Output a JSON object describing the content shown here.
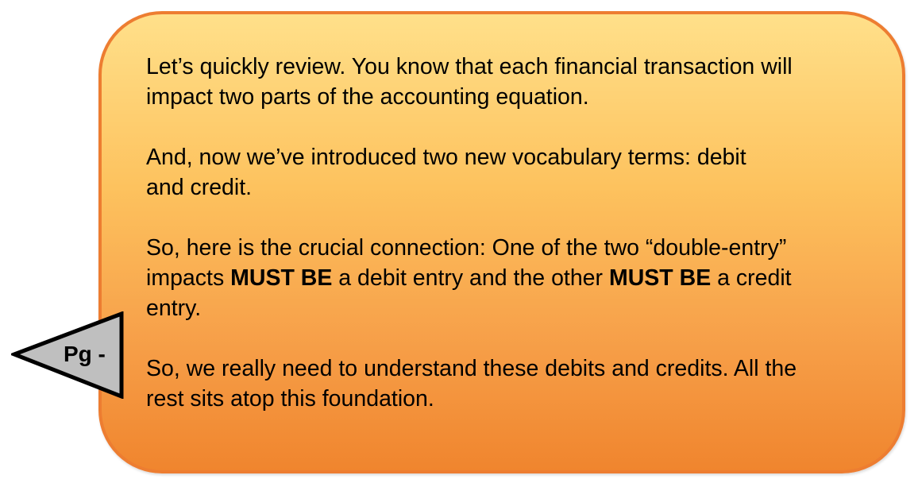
{
  "callout": {
    "p1_line1": "Let’s quickly review. You know that each financial transaction will",
    "p1_line2": "impact two parts of the accounting equation.",
    "p2_line1": "And, now we’ve introduced two new vocabulary terms: debit",
    "p2_line2": "and credit.",
    "p3_line1": "So, here is the crucial connection: One of the two “double-entry”",
    "p3_line2_a": "impacts ",
    "p3_line2_b": "MUST BE",
    "p3_line2_c": " a debit entry and the other ",
    "p3_line2_d": "MUST BE",
    "p3_line2_e": " a credit",
    "p3_line3": "entry.",
    "p4_line1": "So, we really need to understand these debits and credits. All the",
    "p4_line2": "rest sits atop this foundation."
  },
  "page_tab": {
    "label": "Pg -"
  },
  "colors": {
    "border": "#ED7D31",
    "gradient_top": "#FFE08A",
    "gradient_bottom": "#F0852E",
    "tab_fill": "#BFBFBF"
  }
}
